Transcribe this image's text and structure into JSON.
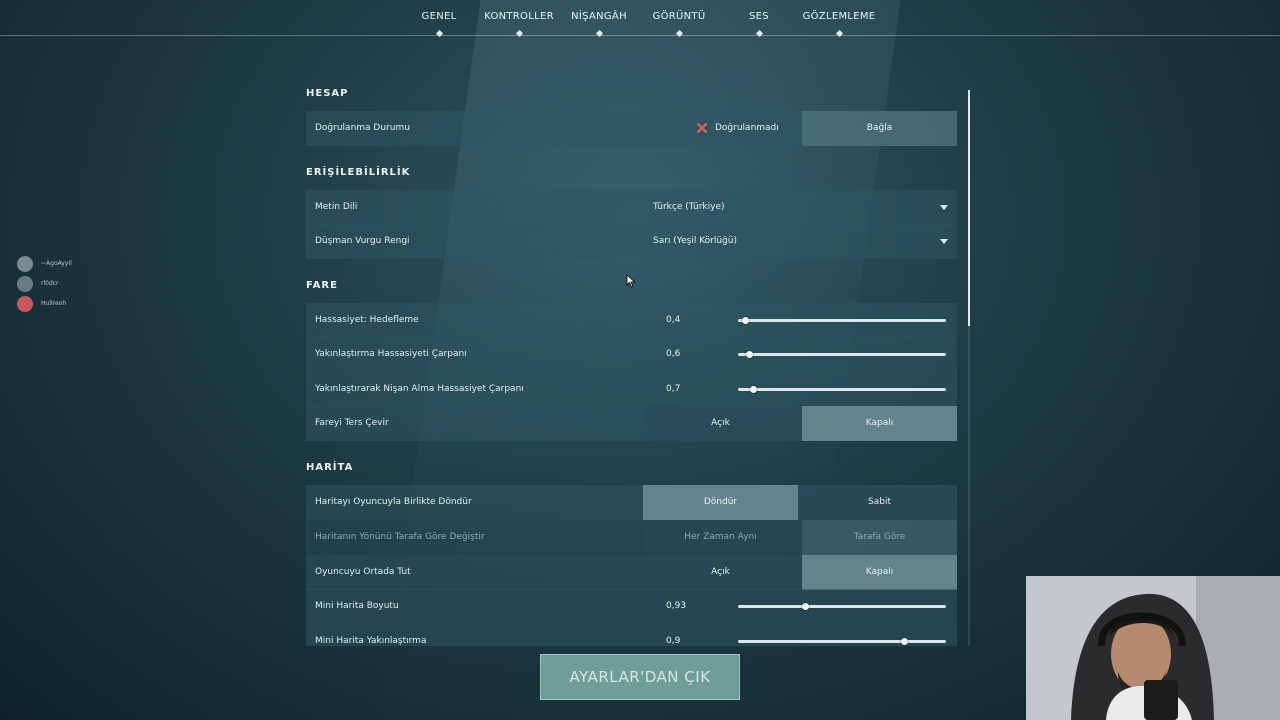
{
  "nav": {
    "tabs": [
      {
        "label": "GENEL"
      },
      {
        "label": "KONTROLLER"
      },
      {
        "label": "NİŞANGÂH"
      },
      {
        "label": "GÖRÜNTÜ"
      },
      {
        "label": "SES"
      },
      {
        "label": "GÖZLEMLEME"
      }
    ]
  },
  "sections": {
    "hesap": {
      "title": "HESAP",
      "verification_label": "Doğrulanma Durumu",
      "verification_status": "Doğrulanmadı",
      "bind_button": "Bağla"
    },
    "erisilebilirlik": {
      "title": "ERİŞİLEBİLİRLİK",
      "text_language_label": "Metin Dili",
      "text_language_value": "Türkçe (Türkiye)",
      "enemy_highlight_label": "Düşman Vurgu Rengi",
      "enemy_highlight_value": "Sarı (Yeşil Körlüğü)"
    },
    "fare": {
      "title": "FARE",
      "sensitivity_label": "Hassasiyet: Hedefleme",
      "sensitivity_value": "0,4",
      "sensitivity_fraction": 0.02,
      "zoom_mult_label": "Yakınlaştırma Hassasiyeti Çarpanı",
      "zoom_mult_value": "0,6",
      "zoom_mult_fraction": 0.04,
      "ads_mult_label": "Yakınlaştırarak Nişan Alma Hassasiyet Çarpanı",
      "ads_mult_value": "0,7",
      "ads_mult_fraction": 0.06,
      "invert_label": "Fareyi Ters Çevir",
      "invert_on": "Açık",
      "invert_off": "Kapalı"
    },
    "harita": {
      "title": "HARİTA",
      "rotate_label": "Haritayı Oyuncuyla Birlikte Döndür",
      "rotate_option": "Döndür",
      "fixed_option": "Sabit",
      "orientation_label": "Haritanın Yönünü Tarafa Göre Değiştir",
      "always_same_option": "Her Zaman Aynı",
      "by_side_option": "Tarafa Göre",
      "keep_center_label": "Oyuncuyu Ortada Tut",
      "keep_center_on": "Açık",
      "keep_center_off": "Kapalı",
      "minimap_size_label": "Mini Harita Boyutu",
      "minimap_size_value": "0,93",
      "minimap_size_fraction": 0.32,
      "minimap_zoom_label": "Mini Harita Yakınlaştırma",
      "minimap_zoom_value": "0,9",
      "minimap_zoom_fraction": 0.81
    }
  },
  "exit_button": "AYARLAR'DAN ÇIK",
  "friends": [
    {
      "name": "~AgoAyyil"
    },
    {
      "name": "rl0dcr"
    },
    {
      "name": "Hullreoh"
    }
  ],
  "colors": {
    "status_x": "#e0605a",
    "exit_button": "#6e9e96"
  }
}
